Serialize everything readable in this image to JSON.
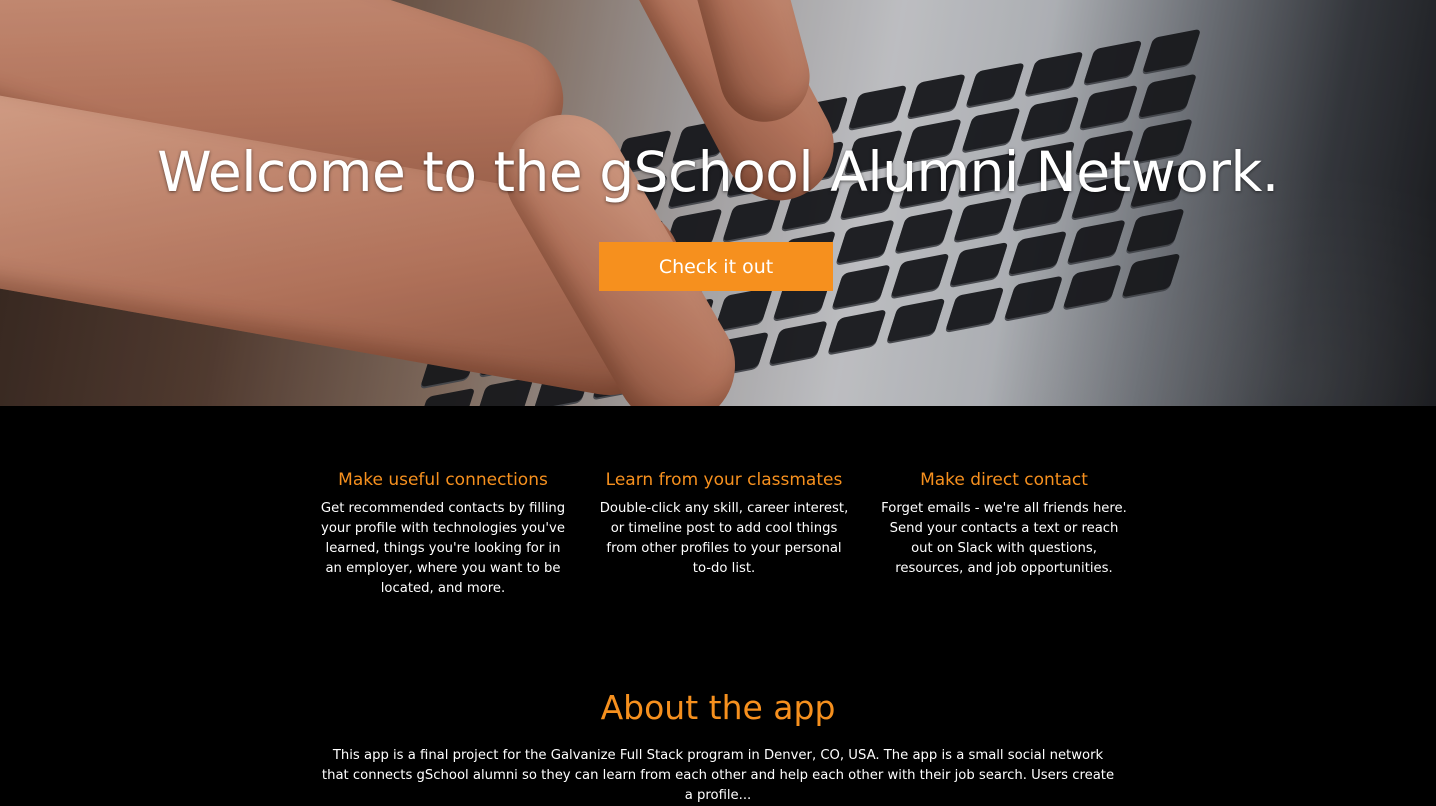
{
  "hero": {
    "title": "Welcome to the gSchool Alumni Network.",
    "cta_label": "Check it out",
    "background": "hands-typing-on-laptop-keyboard"
  },
  "features": [
    {
      "title": "Make useful connections",
      "text": "Get recommended contacts by filling your profile with technologies you've learned, things you're looking for in an employer, where you want to be located, and more."
    },
    {
      "title": "Learn from your classmates",
      "text": "Double-click any skill, career interest, or timeline post to add cool things from other profiles to your personal to-do list."
    },
    {
      "title": "Make direct contact",
      "text": "Forget emails - we're all friends here. Send your contacts a text or reach out on Slack with questions, resources, and job opportunities."
    }
  ],
  "about": {
    "title": "About the app",
    "text": "This app is a final project for the Galvanize Full Stack program in Denver, CO, USA. The app is a small social network that connects gSchool alumni so they can learn from each other and help each other with their job search. Users create a profile..."
  },
  "colors": {
    "accent": "#f6901e",
    "background": "#000000",
    "text": "#ffffff"
  }
}
